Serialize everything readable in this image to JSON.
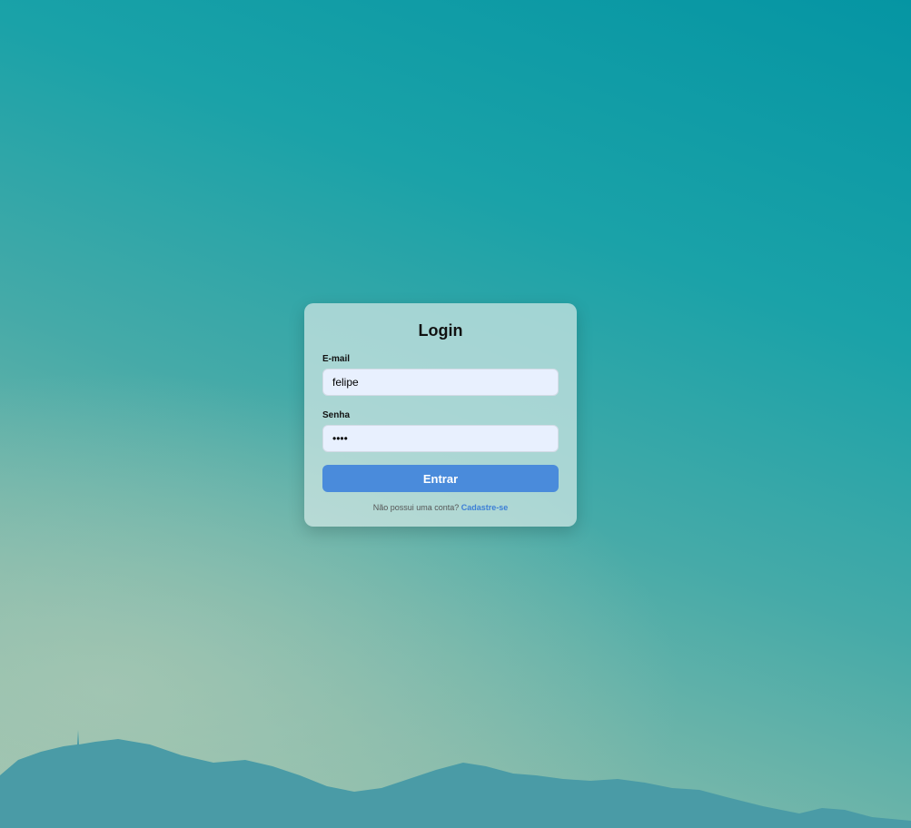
{
  "login": {
    "title": "Login",
    "email_label": "E-mail",
    "email_value": "felipe",
    "password_label": "Senha",
    "password_value": "1234",
    "submit_label": "Entrar",
    "signup_prompt": "Não possui uma conta?",
    "signup_link": "Cadastre-se"
  },
  "colors": {
    "accent": "#4a8bdb",
    "link": "#3d7fd6",
    "background_top": "#0595a3",
    "background_bottom": "#9cc4ae"
  }
}
